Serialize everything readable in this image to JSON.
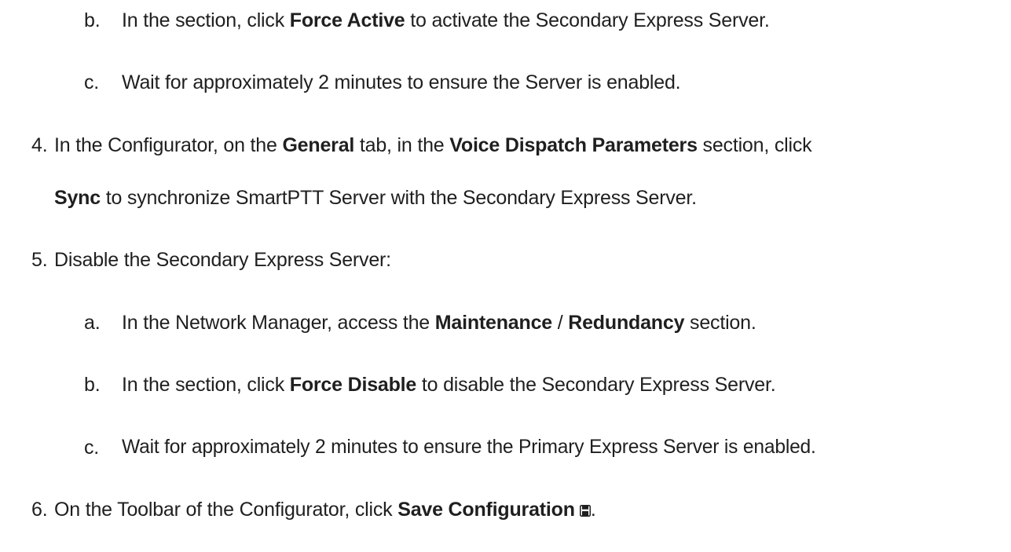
{
  "steps": [
    {
      "marker": "b.",
      "parts": [
        {
          "text": "In the section, click ",
          "bold": false
        },
        {
          "text": "Force Active",
          "bold": true
        },
        {
          "text": " to activate the Secondary Express Server.",
          "bold": false
        }
      ]
    },
    {
      "marker": "c.",
      "parts": [
        {
          "text": "Wait for approximately 2 minutes to ensure the Server is enabled.",
          "bold": false
        }
      ]
    },
    {
      "marker": "4.",
      "parts": [
        {
          "text": "In the Configurator, on the ",
          "bold": false
        },
        {
          "text": "General",
          "bold": true
        },
        {
          "text": " tab, in the ",
          "bold": false
        },
        {
          "text": "Voice Dispatch Parameters",
          "bold": true
        },
        {
          "text": " section, click",
          "bold": false
        }
      ]
    },
    {
      "marker": "",
      "parts": [
        {
          "text": "Sync",
          "bold": true
        },
        {
          "text": " to synchronize SmartPTT Server with the Secondary Express Server.",
          "bold": false
        }
      ]
    },
    {
      "marker": "5.",
      "parts": [
        {
          "text": "Disable the Secondary Express Server:",
          "bold": false
        }
      ]
    },
    {
      "marker": "a.",
      "parts": [
        {
          "text": "In the Network Manager, access the ",
          "bold": false
        },
        {
          "text": "Maintenance",
          "bold": true
        },
        {
          "text": " / ",
          "bold": false
        },
        {
          "text": "Redundancy",
          "bold": true
        },
        {
          "text": " section.",
          "bold": false
        }
      ]
    },
    {
      "marker": "b.",
      "parts": [
        {
          "text": "In the section, click ",
          "bold": false
        },
        {
          "text": "Force Disable",
          "bold": true
        },
        {
          "text": " to disable the Secondary Express Server.",
          "bold": false
        }
      ]
    },
    {
      "marker": "c.",
      "parts": [
        {
          "text": "Wait for approximately 2 minutes to ensure the Primary Express Server is enabled.",
          "bold": false
        }
      ]
    },
    {
      "marker": "6.",
      "parts": [
        {
          "text": "On the Toolbar of the Configurator, click ",
          "bold": false
        },
        {
          "text": "Save Configuration",
          "bold": true
        },
        {
          "text": ".",
          "bold": false
        }
      ],
      "icon": "save-icon",
      "icon_after_part": 1
    }
  ]
}
